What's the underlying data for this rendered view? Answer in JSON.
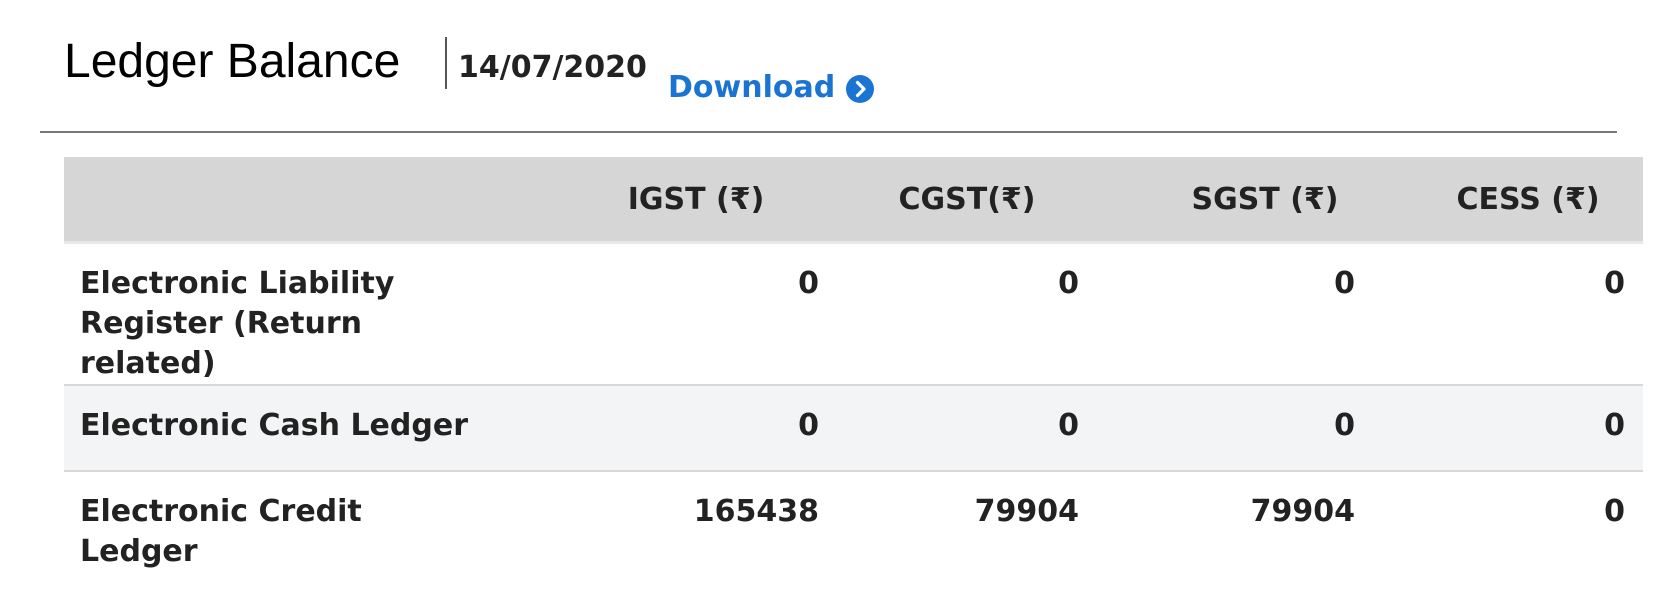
{
  "header": {
    "title": "Ledger Balance",
    "date": "14/07/2020",
    "download_label": "Download",
    "download_icon": "chevron-right-circle-icon",
    "accent_color": "#1a74d1"
  },
  "table": {
    "columns": [
      "",
      "IGST (₹)",
      "CGST(₹)",
      "SGST (₹)",
      "CESS (₹)"
    ],
    "rows": [
      {
        "label": "Electronic Liability Register (Return related)",
        "igst": "0",
        "cgst": "0",
        "sgst": "0",
        "cess": "0"
      },
      {
        "label": "Electronic Cash Ledger",
        "igst": "0",
        "cgst": "0",
        "sgst": "0",
        "cess": "0"
      },
      {
        "label": "Electronic Credit Ledger",
        "igst": "165438",
        "cgst": "79904",
        "sgst": "79904",
        "cess": "0"
      }
    ]
  }
}
